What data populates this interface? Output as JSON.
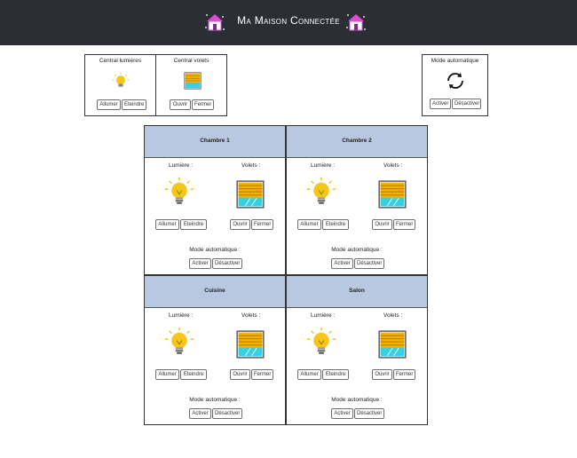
{
  "header": {
    "title": "Ma Maison Connectée"
  },
  "central_lights": {
    "label": "Central lumières",
    "on": "Allumer",
    "off": "Eteindre"
  },
  "central_blinds": {
    "label": "Central volets",
    "open": "Ouvrir",
    "close": "Fermer"
  },
  "auto_mode": {
    "label": "Mode automatique",
    "activate": "Activer",
    "deactivate": "Désactiver"
  },
  "room_labels": {
    "light": "Lumière :",
    "blinds": "Volets :",
    "auto": "Mode automatique :",
    "on": "Allumer",
    "off": "Eteindre",
    "open": "Ouvrir",
    "close": "Fermer",
    "activate": "Activer",
    "deactivate": "Désactiver"
  },
  "rooms": [
    {
      "name": "Chambre 1"
    },
    {
      "name": "Chambre 2"
    },
    {
      "name": "Cuisine"
    },
    {
      "name": "Salon"
    }
  ],
  "colors": {
    "header_bg": "#2b2f35",
    "room_header": "#b7c8e0",
    "bulb": "#f5c518",
    "blind_slat": "#f3b100",
    "window": "#35d0e8"
  }
}
